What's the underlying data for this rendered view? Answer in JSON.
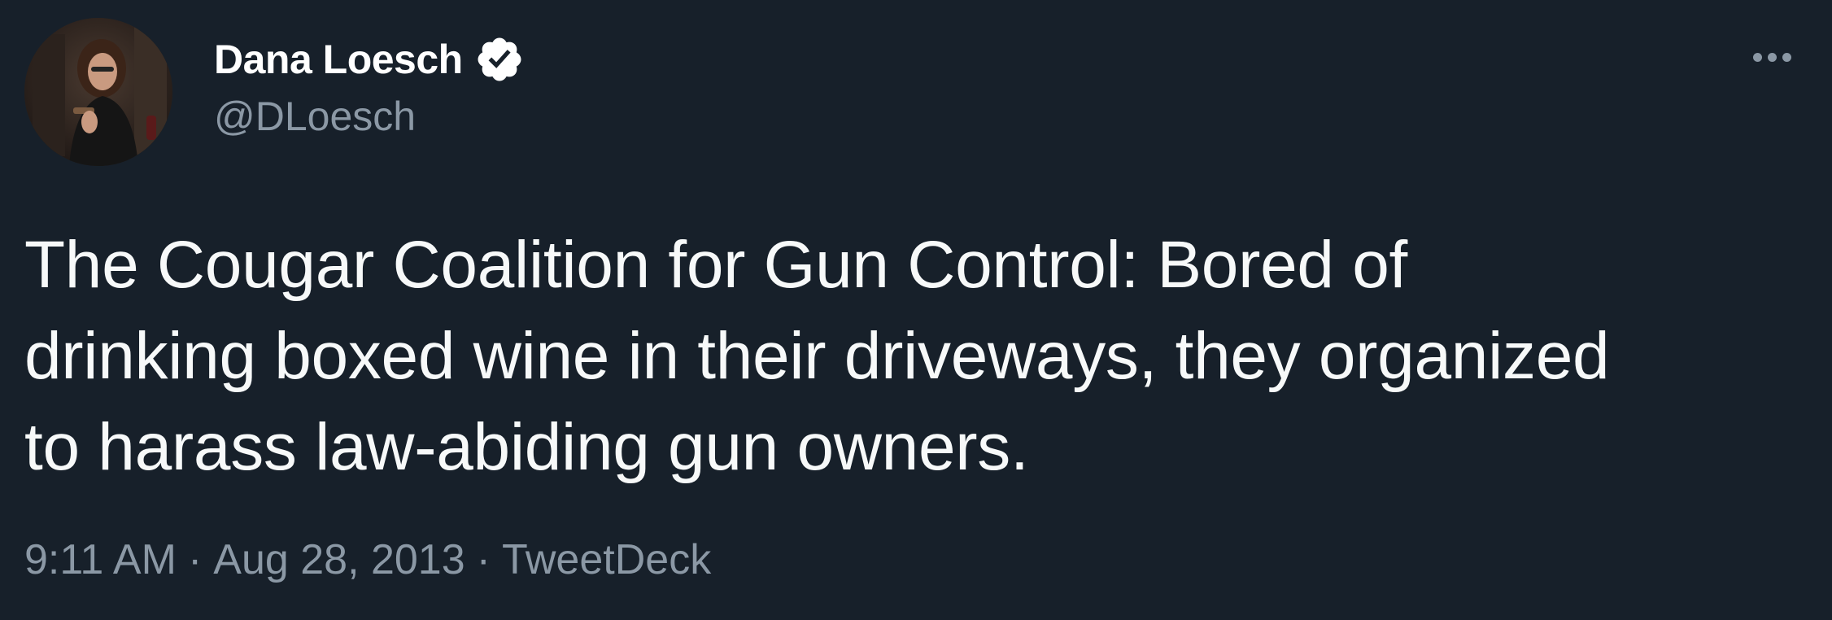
{
  "author": {
    "display_name": "Dana Loesch",
    "handle": "@DLoesch",
    "verified": true
  },
  "tweet": {
    "lines": [
      "The Cougar Coalition for Gun Control: Bored of",
      "drinking boxed wine in their driveways, they organized",
      "to harass law-abiding gun owners."
    ],
    "time": "9:11 AM",
    "date": "Aug 28, 2013",
    "source": "TweetDeck",
    "separator": "·"
  },
  "icons": {
    "verified": "verified-badge-icon",
    "more": "more-options-icon"
  },
  "colors": {
    "background": "#17202a",
    "text": "#f7f9f9",
    "secondary_text": "#8b98a5"
  }
}
